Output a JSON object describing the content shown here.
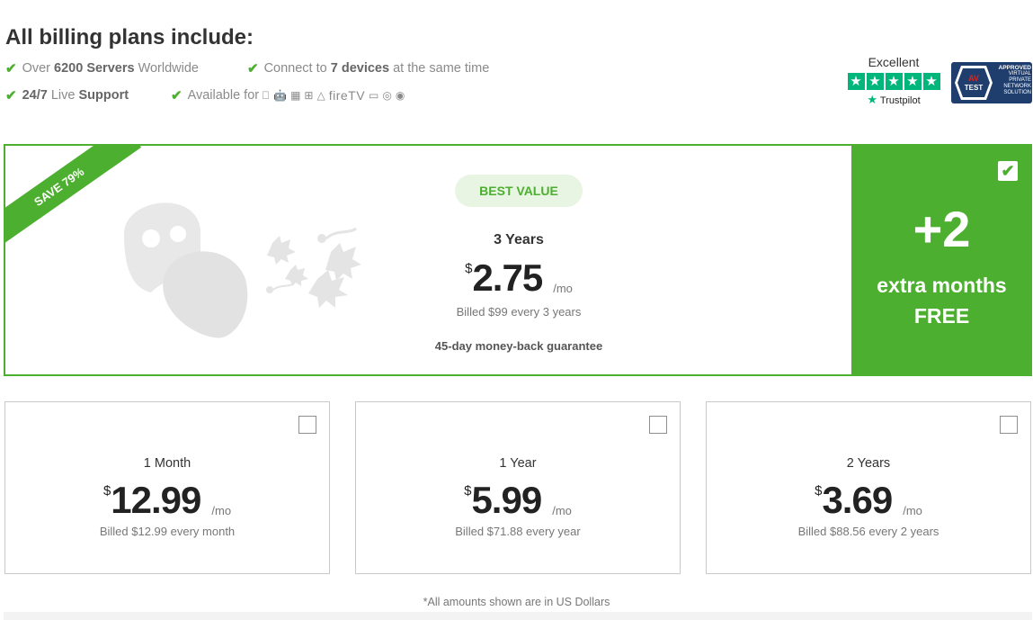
{
  "heading": "All billing plans include:",
  "features": {
    "servers": {
      "pre": "Over ",
      "bold": "6200 Servers",
      "post": " Worldwide"
    },
    "devices": {
      "pre": "Connect to ",
      "bold": "7 devices",
      "post": " at the same time"
    },
    "support": {
      "bold1": "24/7",
      "mid": " Live ",
      "bold2": "Support"
    },
    "available": {
      "label": "Available for",
      "platforms": [
        "apple-icon",
        "android-icon",
        "finder-icon",
        "windows-icon",
        "linux-icon",
        "firetv-logo",
        "tv-icon",
        "chrome-icon",
        "firefox-icon"
      ],
      "firetv": "fireTV"
    }
  },
  "trustpilot": {
    "rating": "Excellent",
    "stars": 5,
    "brand": "Trustpilot"
  },
  "avtest": {
    "logo": "AV TEST",
    "lines": [
      "APPROVED",
      "VIRTUAL",
      "PRIVATE",
      "NETWORK",
      "SOLUTION"
    ]
  },
  "best_plan": {
    "ribbon": "SAVE 79%",
    "badge": "BEST VALUE",
    "name": "3 Years",
    "currency": "$",
    "price": "2.75",
    "per": "/mo",
    "billed": "Billed $99 every 3 years",
    "guarantee": "45-day money-back guarantee",
    "bonus": "+2",
    "bonus_line1": "extra months",
    "bonus_line2": "FREE",
    "selected": true
  },
  "plans": [
    {
      "name": "1 Month",
      "currency": "$",
      "price": "12.99",
      "per": "/mo",
      "billed": "Billed $12.99 every month",
      "selected": false
    },
    {
      "name": "1 Year",
      "currency": "$",
      "price": "5.99",
      "per": "/mo",
      "billed": "Billed $71.88 every year",
      "selected": false
    },
    {
      "name": "2 Years",
      "currency": "$",
      "price": "3.69",
      "per": "/mo",
      "billed": "Billed $88.56 every 2 years",
      "selected": false
    }
  ],
  "note": "*All amounts shown are in US Dollars",
  "colors": {
    "accent": "#4caf2f",
    "trustpilot": "#00b67a",
    "avtest": "#1f3e6d"
  }
}
